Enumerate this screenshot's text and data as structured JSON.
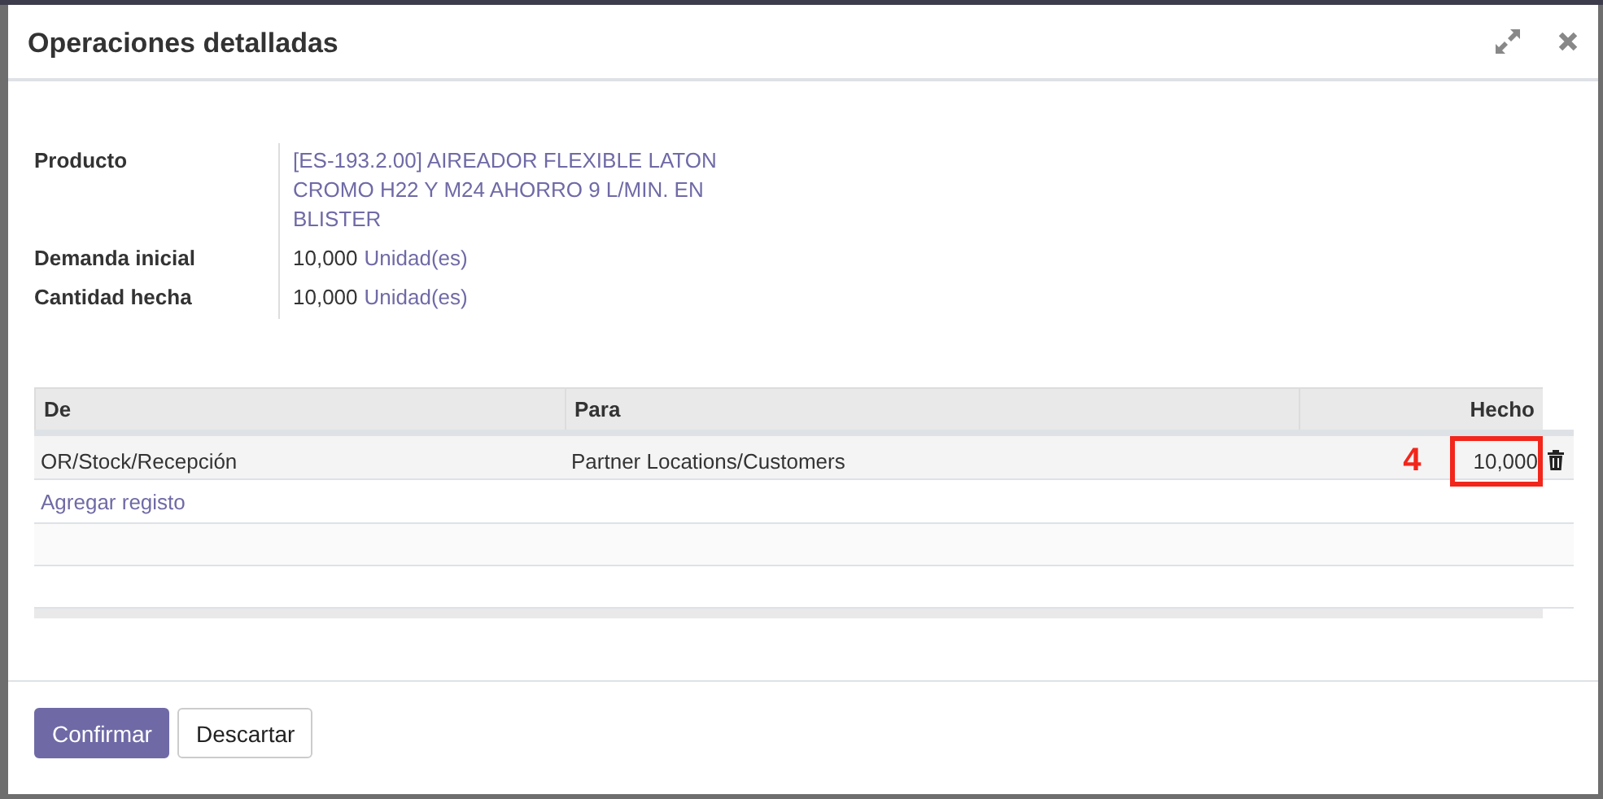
{
  "dialog": {
    "title": "Operaciones detalladas"
  },
  "fields": [
    {
      "label": "Producto",
      "kind": "link",
      "value": "[ES-193.2.00] AIREADOR FLEXIBLE LATON CROMO H22 Y M24 AHORRO 9 L/MIN. EN BLISTER"
    },
    {
      "label": "Demanda inicial",
      "kind": "quantity",
      "value": "10,000",
      "unit": "Unidad(es)"
    },
    {
      "label": "Cantidad hecha",
      "kind": "quantity",
      "value": "10,000",
      "unit": "Unidad(es)"
    }
  ],
  "table": {
    "columns": [
      "De",
      "Para",
      "Hecho"
    ],
    "rows": [
      {
        "cells": [
          "OR/Stock/Recepción",
          "Partner Locations/Customers",
          "10,000"
        ]
      }
    ],
    "add_line": "Agregar registo"
  },
  "annotation": {
    "label": "4"
  },
  "buttons": [
    {
      "label": "Confirmar",
      "kind": "primary"
    },
    {
      "label": "Descartar",
      "kind": "secondary"
    }
  ]
}
